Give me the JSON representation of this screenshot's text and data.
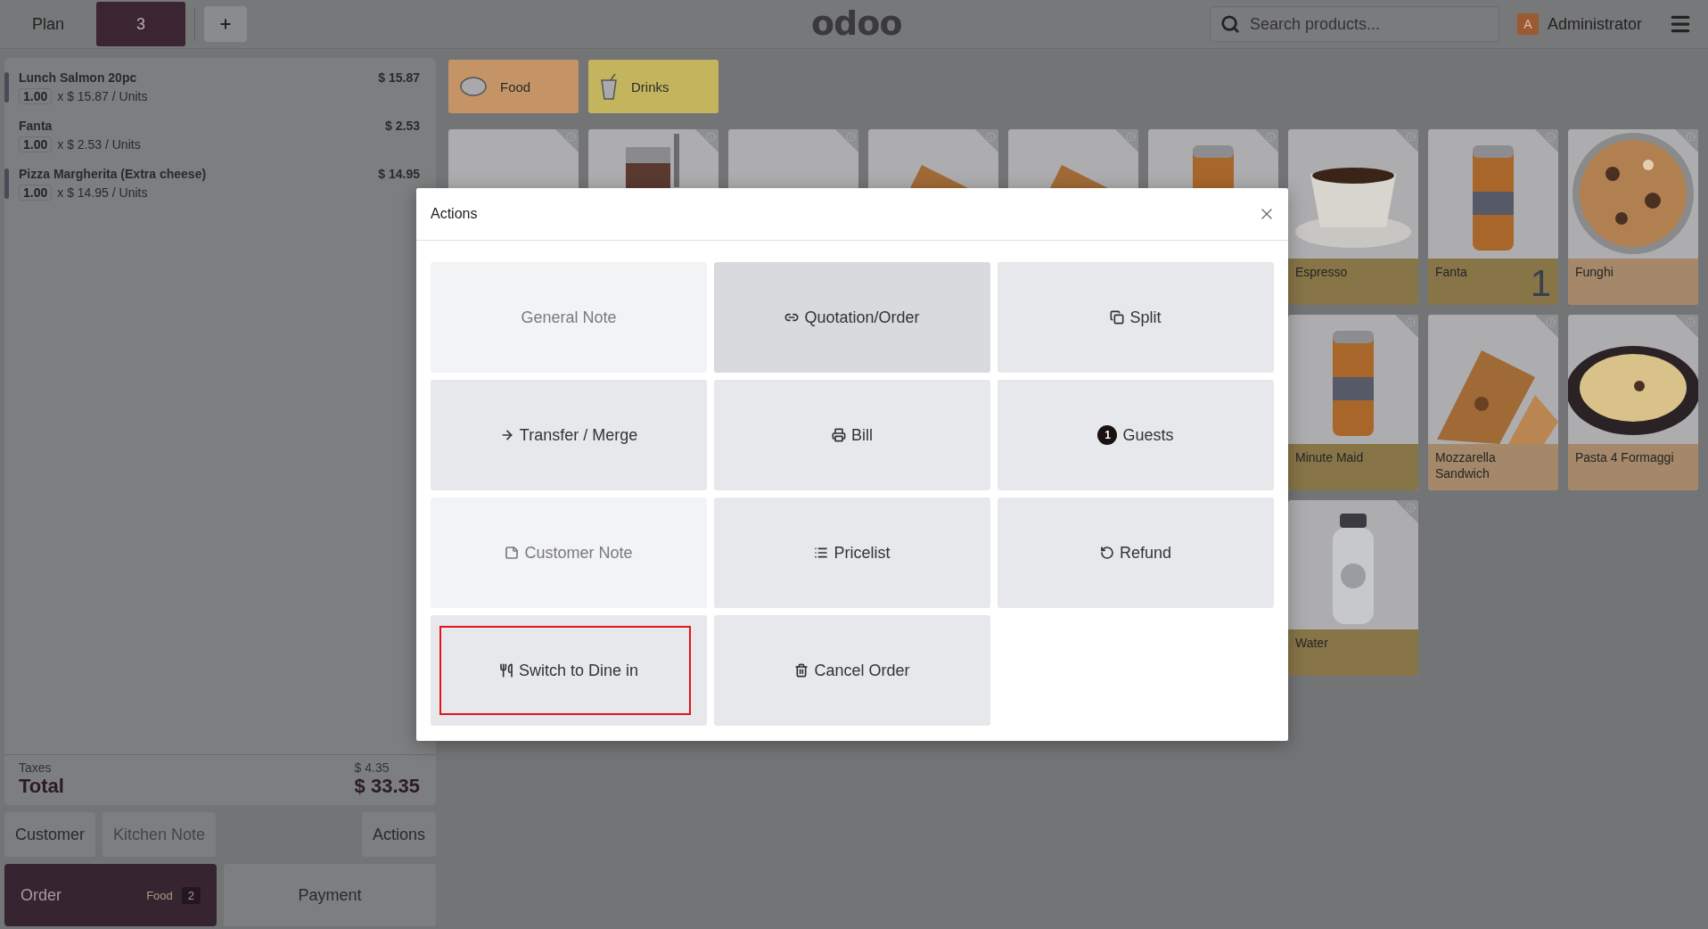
{
  "top_bar": {
    "plan_button": "Plan",
    "tabs": [
      {
        "label": "3",
        "selected": true
      }
    ],
    "logo": "odoo",
    "search": {
      "placeholder": "Search products..."
    },
    "user": {
      "initial": "A",
      "name": "Administrator"
    }
  },
  "order": {
    "lines": [
      {
        "name": "Lunch Salmon 20pc",
        "qty": "1.00",
        "unit_price": "x $ 15.87 / Units",
        "price": "$ 15.87",
        "flagged": true
      },
      {
        "name": "Fanta",
        "qty": "1.00",
        "unit_price": "x $ 2.53 / Units",
        "price": "$ 2.53",
        "flagged": false
      },
      {
        "name": "Pizza Margherita (Extra cheese)",
        "qty": "1.00",
        "unit_price": "x $ 14.95 / Units",
        "price": "$ 14.95",
        "flagged": true
      }
    ],
    "taxes_label": "Taxes",
    "taxes": "$ 4.35",
    "total_label": "Total",
    "total": "$ 33.35",
    "buttons": [
      {
        "label": "Customer",
        "disabled": false
      },
      {
        "label": "Kitchen Note",
        "disabled": true
      },
      {
        "label": "Actions",
        "disabled": false
      }
    ],
    "order_button": {
      "label": "Order",
      "category": "Food",
      "badge": "2"
    },
    "payment_button": "Payment"
  },
  "categories": [
    {
      "label": "Food",
      "color": "#c49466"
    },
    {
      "label": "Drinks",
      "color": "#c4b45e"
    }
  ],
  "products": [
    [
      {
        "kind": "picture"
      },
      {
        "kind": "picture"
      },
      {
        "kind": "picture"
      },
      {
        "kind": "picture"
      },
      {
        "kind": "picture"
      },
      {
        "kind": "picture"
      },
      {
        "name": "Espresso",
        "color": "#877548"
      },
      {
        "name": "Fanta",
        "color": "#877548",
        "count": "1"
      },
      {
        "name": "Funghi",
        "color": "#a48869"
      }
    ],
    [
      {
        "name": "Minute Maid",
        "color": "#877548"
      },
      {
        "name": "Mozzarella Sandwich",
        "color": "#a48869"
      },
      {
        "name": "Pasta 4 Formaggi",
        "color": "#a48869"
      }
    ],
    [
      {
        "name": "Water",
        "color": "#877548"
      }
    ]
  ],
  "dialog": {
    "title": "Actions",
    "actions": [
      {
        "label": "General Note",
        "kind": "plain",
        "disabled": true,
        "active": false,
        "highlighted": false
      },
      {
        "label": "Quotation/Order",
        "kind": "link",
        "disabled": false,
        "active": true,
        "highlighted": false
      },
      {
        "label": "Split",
        "kind": "copy",
        "disabled": false,
        "active": false,
        "highlighted": false
      },
      {
        "label": "Transfer / Merge",
        "kind": "arrow",
        "disabled": false,
        "active": false,
        "highlighted": false
      },
      {
        "label": "Bill",
        "kind": "print",
        "disabled": false,
        "active": false,
        "highlighted": false
      },
      {
        "label": "Guests",
        "kind": "guests",
        "badge": "1",
        "disabled": false,
        "active": false,
        "highlighted": false
      },
      {
        "label": "Customer Note",
        "kind": "note",
        "disabled": true,
        "active": false,
        "highlighted": false
      },
      {
        "label": "Pricelist",
        "kind": "list",
        "disabled": false,
        "active": false,
        "highlighted": false
      },
      {
        "label": "Refund",
        "kind": "undo",
        "disabled": false,
        "active": false,
        "highlighted": false
      },
      {
        "label": "Switch to Dine in",
        "kind": "cutlery",
        "disabled": false,
        "active": false,
        "highlighted": true
      },
      {
        "label": "Cancel Order",
        "kind": "trash",
        "disabled": false,
        "active": false,
        "highlighted": false
      }
    ]
  }
}
